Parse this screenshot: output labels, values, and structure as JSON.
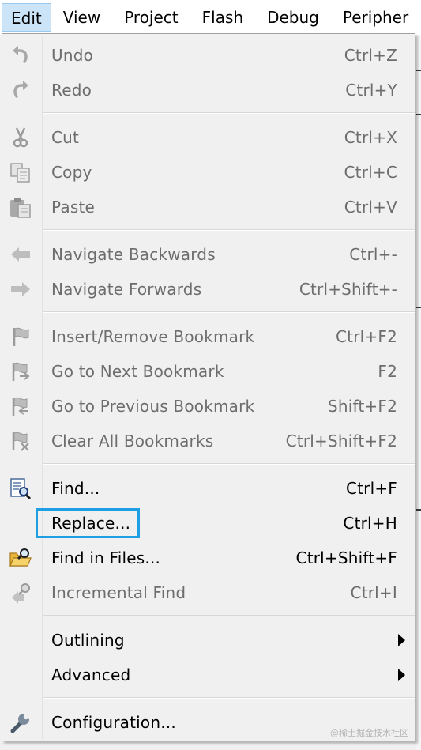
{
  "menubar": {
    "items": [
      "Edit",
      "View",
      "Project",
      "Flash",
      "Debug",
      "Peripher"
    ]
  },
  "colors": {
    "menu_bg": "#f0f0f0",
    "active_menu_bg": "#cce4f7",
    "disabled_text": "#6d6d6d",
    "highlight_box": "#1e9fe3"
  },
  "edit_menu": {
    "undo": {
      "label": "Undo",
      "shortcut": "Ctrl+Z",
      "icon": "undo-icon",
      "enabled": false
    },
    "redo": {
      "label": "Redo",
      "shortcut": "Ctrl+Y",
      "icon": "redo-icon",
      "enabled": false
    },
    "cut": {
      "label": "Cut",
      "shortcut": "Ctrl+X",
      "icon": "scissors-icon",
      "enabled": false
    },
    "copy": {
      "label": "Copy",
      "shortcut": "Ctrl+C",
      "icon": "copy-icon",
      "enabled": false
    },
    "paste": {
      "label": "Paste",
      "shortcut": "Ctrl+V",
      "icon": "paste-icon",
      "enabled": false
    },
    "nav_back": {
      "label": "Navigate Backwards",
      "shortcut": "Ctrl+-",
      "icon": "arrow-left-icon",
      "enabled": false
    },
    "nav_fwd": {
      "label": "Navigate Forwards",
      "shortcut": "Ctrl+Shift+-",
      "icon": "arrow-right-icon",
      "enabled": false
    },
    "bookmark_toggle": {
      "label": "Insert/Remove Bookmark",
      "shortcut": "Ctrl+F2",
      "icon": "bookmark-flag-icon",
      "enabled": false
    },
    "bookmark_next": {
      "label": "Go to Next Bookmark",
      "shortcut": "F2",
      "icon": "bookmark-next-icon",
      "enabled": false
    },
    "bookmark_prev": {
      "label": "Go to Previous Bookmark",
      "shortcut": "Shift+F2",
      "icon": "bookmark-prev-icon",
      "enabled": false
    },
    "bookmark_clear": {
      "label": "Clear All Bookmarks",
      "shortcut": "Ctrl+Shift+F2",
      "icon": "bookmark-clear-icon",
      "enabled": false
    },
    "find": {
      "label": "Find...",
      "shortcut": "Ctrl+F",
      "icon": "find-document-icon",
      "enabled": true
    },
    "replace": {
      "label": "Replace...",
      "shortcut": "Ctrl+H",
      "enabled": true
    },
    "find_in_files": {
      "label": "Find in Files...",
      "shortcut": "Ctrl+Shift+F",
      "icon": "find-in-files-folder-icon",
      "enabled": true
    },
    "incremental_find": {
      "label": "Incremental Find",
      "shortcut": "Ctrl+I",
      "icon": "incremental-find-icon",
      "enabled": false
    },
    "outlining": {
      "label": "Outlining",
      "submenu": true,
      "enabled": true
    },
    "advanced": {
      "label": "Advanced",
      "submenu": true,
      "enabled": true
    },
    "configuration": {
      "label": "Configuration...",
      "icon": "wrench-icon",
      "enabled": true
    }
  },
  "watermark": "@稀土掘金技术社区"
}
